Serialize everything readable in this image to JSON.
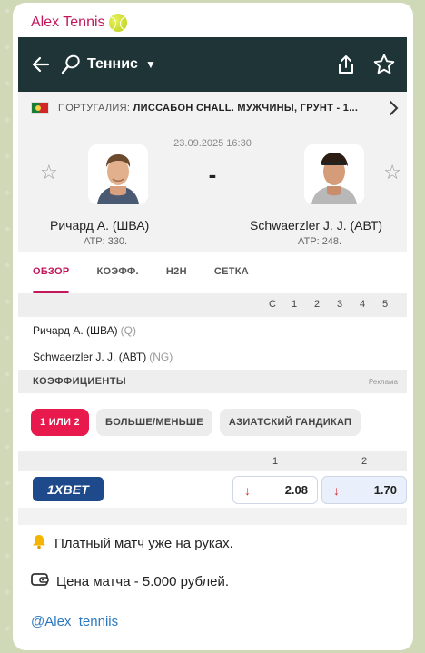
{
  "channel": {
    "name": "Alex Tennis",
    "emoji_icon": "tennis-ball-icon"
  },
  "app": {
    "sport_title": "Теннис",
    "tournament_country": "ПОРТУГАЛИЯ:",
    "tournament_name": "ЛИССАБОН CHALL. МУЖЧИНЫ, ГРУНТ - 1..."
  },
  "match": {
    "datetime": "23.09.2025 16:30",
    "separator": "-",
    "home": {
      "name": "Ричард А. (ШВА)",
      "rank": "ATP: 330."
    },
    "away": {
      "name": "Schwaerzler J. J. (AВТ)",
      "rank": "ATP: 248."
    }
  },
  "tabs": [
    "ОБЗОР",
    "КОЭФФ.",
    "H2H",
    "СЕТКА"
  ],
  "active_tab": 0,
  "score_table": {
    "headers": [
      "С",
      "1",
      "2",
      "3",
      "4",
      "5"
    ],
    "rows": [
      {
        "name": "Ричард А. (ШВА)",
        "status": "(Q)"
      },
      {
        "name": "Schwaerzler J. J. (AВТ)",
        "status": "(NG)"
      }
    ]
  },
  "odds": {
    "section_title": "КОЭФФИЦИЕНТЫ",
    "ad_label": "Реклама",
    "market_chips": [
      "1 ИЛИ 2",
      "БОЛЬШЕ/МЕНЬШЕ",
      "АЗИАТСКИЙ ГАНДИКАП"
    ],
    "columns": [
      "1",
      "2"
    ],
    "bookmaker": "1XBET",
    "values": [
      "2.08",
      "1.70"
    ],
    "trend": [
      "down",
      "down"
    ]
  },
  "message": {
    "line1": "Платный матч уже на руках.",
    "line2": "Цена матча - 5.000 рублей.",
    "handle": "@Alex_tenniis"
  },
  "colors": {
    "accent": "#c2185b",
    "header_bg": "#1e3436",
    "chip_active": "#e8194c",
    "link": "#2a78c2"
  }
}
